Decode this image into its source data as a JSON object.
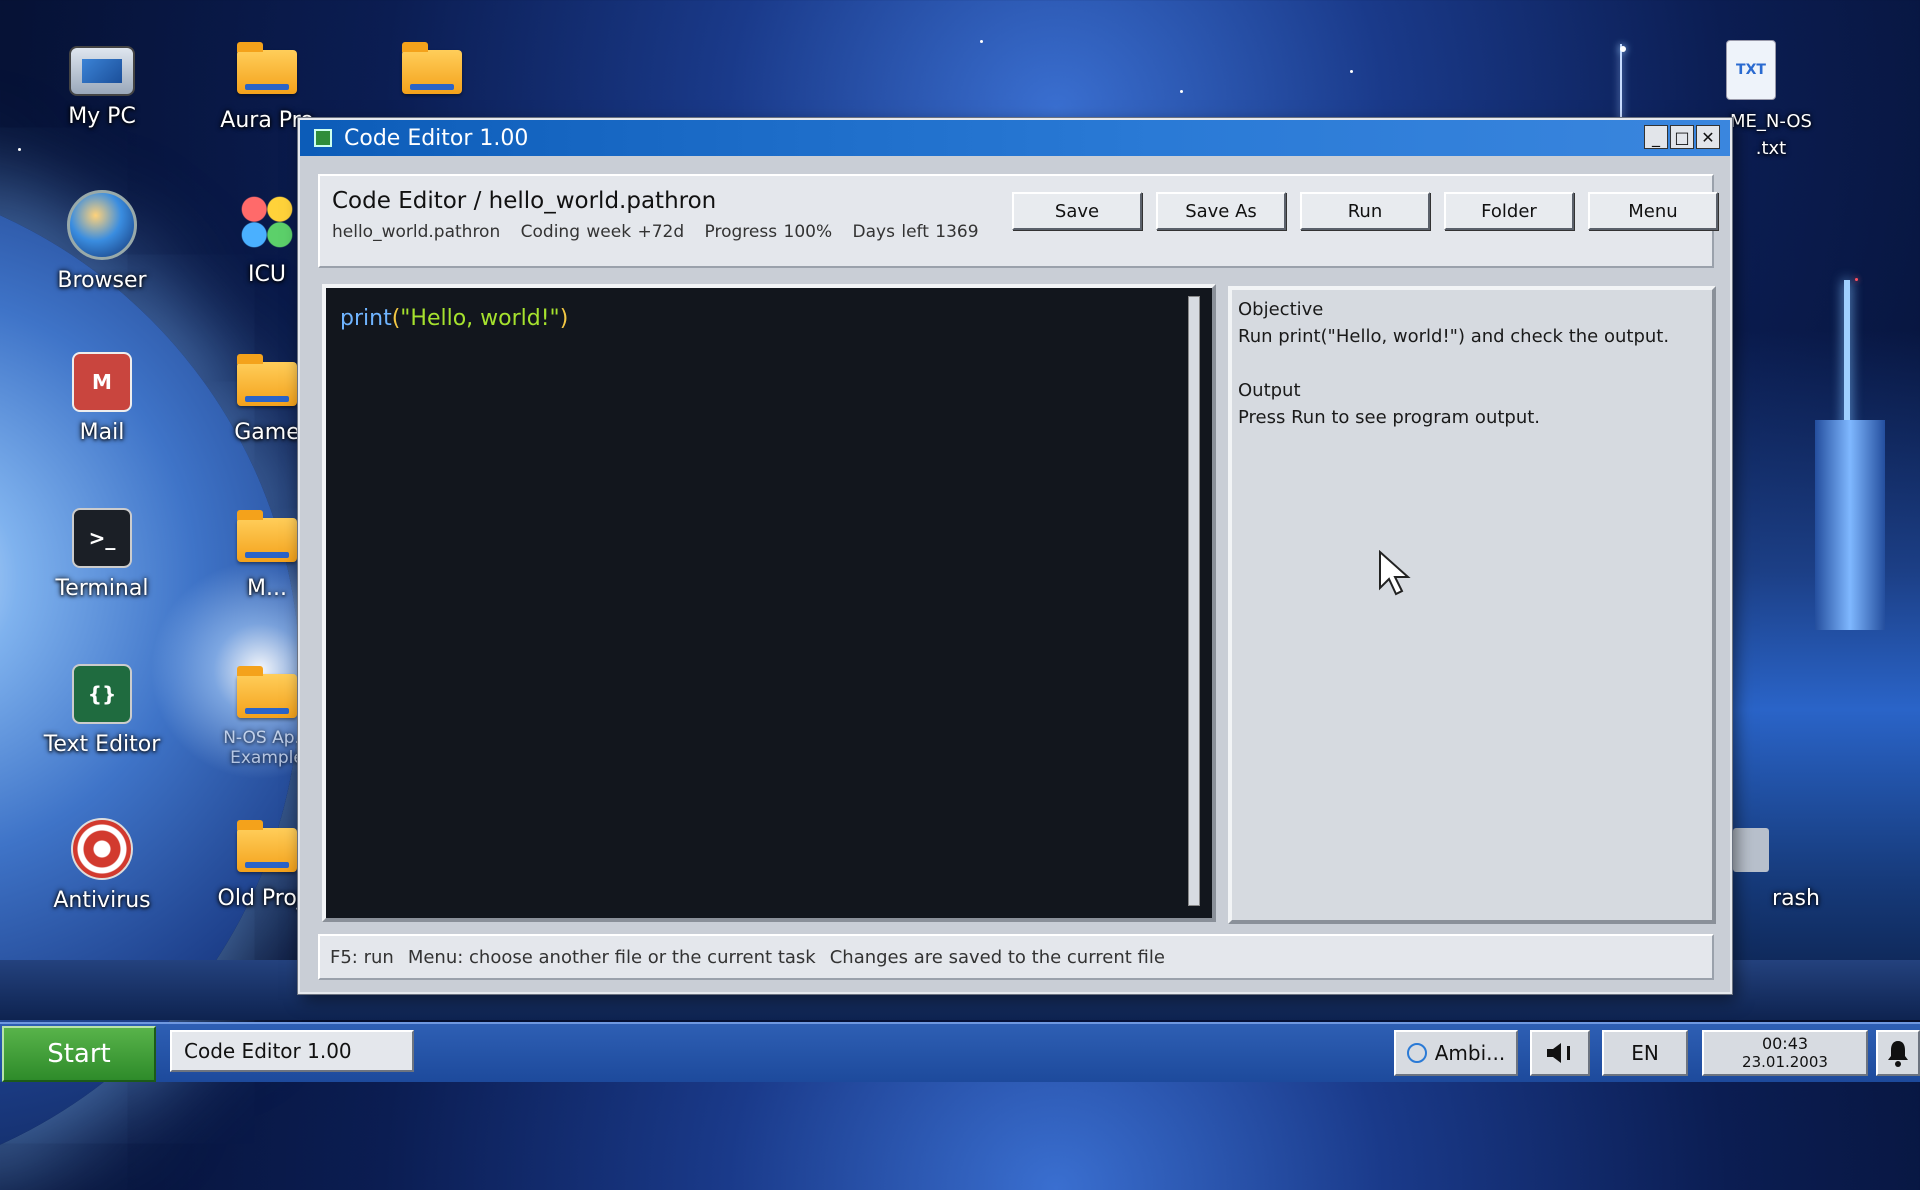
{
  "desktop": {
    "icons": [
      {
        "label": "My PC",
        "icon": "computer-icon"
      },
      {
        "label": "Browser",
        "icon": "globe-icon"
      },
      {
        "label": "Mail",
        "icon": "mail-icon",
        "glyph": "M"
      },
      {
        "label": "Terminal",
        "icon": "terminal-icon",
        "glyph": ">_"
      },
      {
        "label": "Text Editor",
        "icon": "braces-icon",
        "glyph": "{}"
      },
      {
        "label": "Antivirus",
        "icon": "lifebuoy-icon"
      },
      {
        "label": "Aura Pro",
        "icon": "folder-icon"
      },
      {
        "label": "ICU",
        "icon": "flower-icon"
      },
      {
        "label": "Game",
        "icon": "folder-icon"
      },
      {
        "label": "M...",
        "icon": "folder-icon"
      },
      {
        "label": "N-OS Ap... Example",
        "icon": "folder-icon"
      },
      {
        "label": "Old Proje",
        "icon": "folder-icon"
      },
      {
        "label": "",
        "icon": "folder-icon"
      },
      {
        "label": "ME_N-OS .txt",
        "icon": "txt-file-icon",
        "badge": "TXT"
      },
      {
        "label": "rash",
        "icon": "trash-icon"
      }
    ]
  },
  "window": {
    "title": "Code Editor 1.00",
    "controls": [
      "_",
      "□",
      "✕"
    ],
    "header": {
      "title": "Code Editor / hello_world.pathron",
      "file": "hello_world.pathron",
      "coding_week": "Coding week +72d",
      "progress": "Progress 100%",
      "days_left": "Days left 1369"
    },
    "buttons": {
      "save": "Save",
      "save_as": "Save As",
      "run": "Run",
      "folder": "Folder",
      "menu": "Menu"
    },
    "editor": {
      "fn": "print",
      "open": "(",
      "str": "\"Hello, world!\"",
      "close": ")"
    },
    "side": {
      "objective_title": "Objective",
      "objective_text": "Run print(\"Hello, world!\") and check the output.",
      "output_title": "Output",
      "output_text": "Press Run to see program output."
    },
    "status": {
      "hint1": "F5: run",
      "hint2": "Menu: choose another file or the current task",
      "hint3": "Changes are saved to the current file"
    }
  },
  "taskbar": {
    "start": "Start",
    "task": "Code Editor 1.00",
    "ambient": "Ambi...",
    "volume_icon": "speaker-icon",
    "lang": "EN",
    "time": "00:43",
    "date": "23.01.2003",
    "bell_icon": "bell-icon"
  },
  "colors": {
    "titlebar": "#0c5cb8",
    "editor_bg": "#12161d",
    "code_fn": "#6fb4ff",
    "code_str": "#a6e22e",
    "start_green": "#3a9b34"
  }
}
